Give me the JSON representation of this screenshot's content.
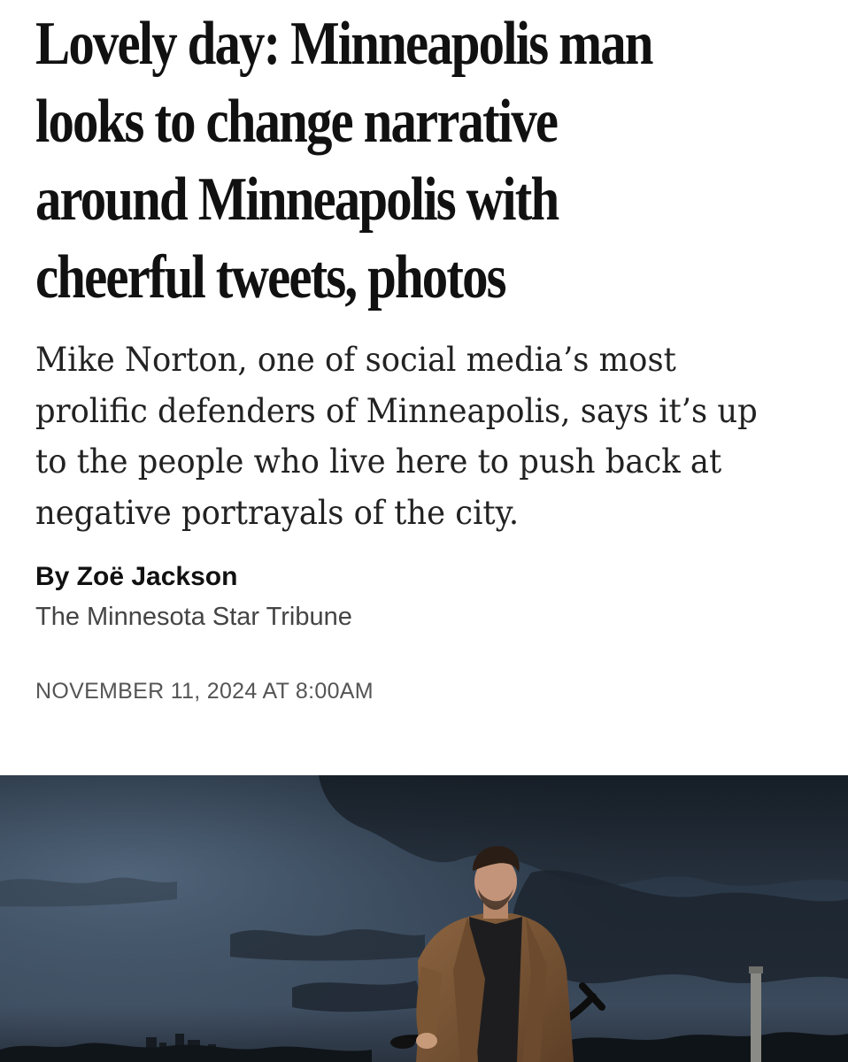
{
  "article": {
    "headline": "Lovely day: Minneapolis man looks to change narrative around Minneapolis with cheerful tweets, photos",
    "dek": "Mike Norton, one of social media’s most prolific defenders of Minneapolis, says it’s up to the people who live here to push back at negative portrayals of the city.",
    "byline": "By Zoë Jackson",
    "publication": "The Minnesota Star Tribune",
    "date": "NOVEMBER 11, 2024 AT 8:00AM"
  },
  "colors": {
    "headline_text": "#111111",
    "body_text": "#222222",
    "meta_text": "#555555",
    "sky_dark": "#1b2430",
    "jacket": "#7a5634"
  }
}
